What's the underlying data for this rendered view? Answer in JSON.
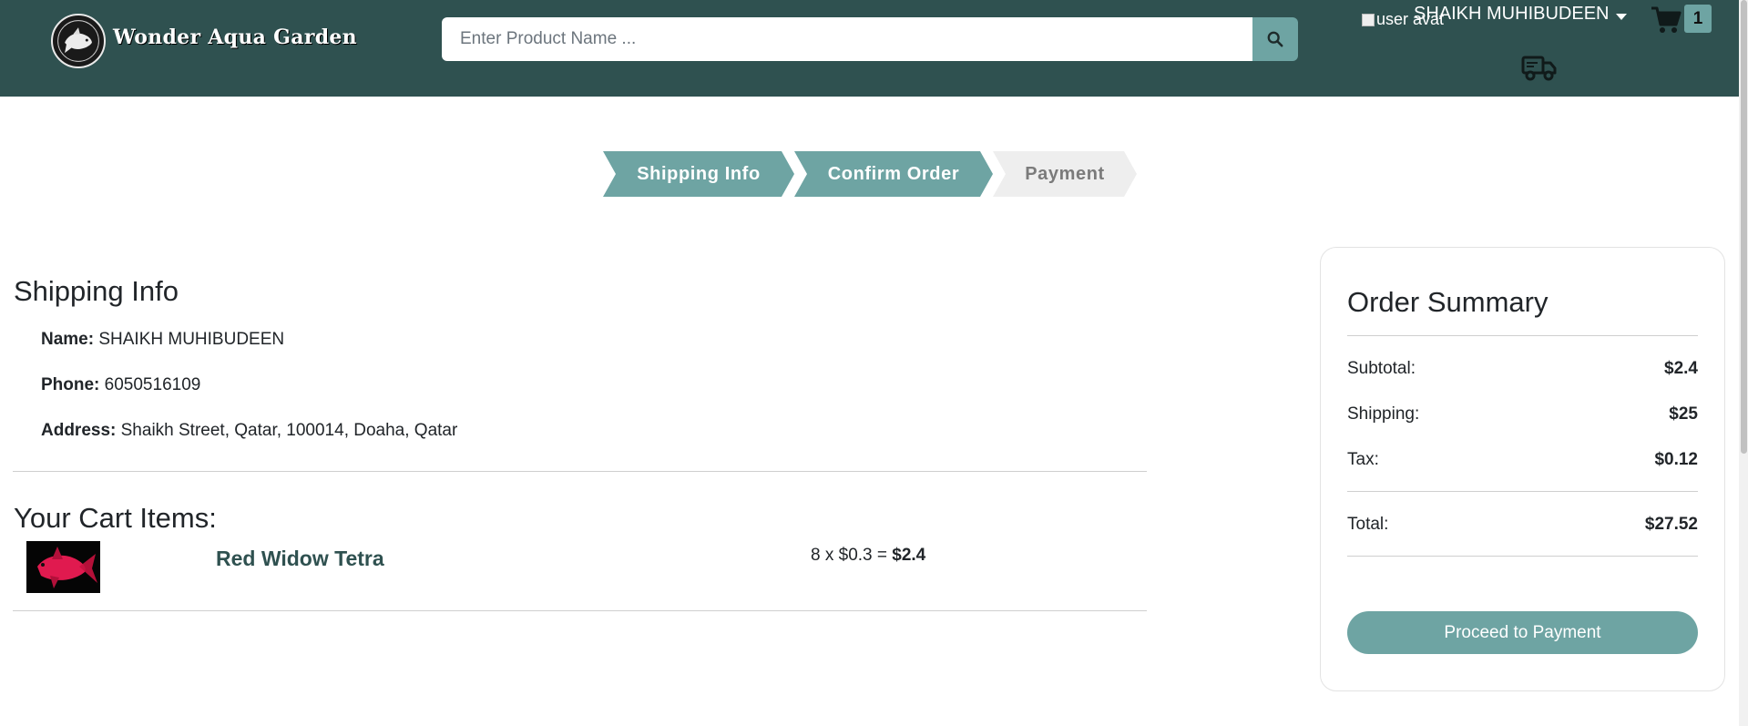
{
  "header": {
    "brand": "Wonder Aqua Garden",
    "logo_icon": "fish-logo-icon",
    "search": {
      "placeholder": "Enter Product Name ...",
      "button_icon": "search-icon"
    },
    "user": {
      "avatar_alt": "user avat",
      "name": "SHAIKH MUHIBUDEEN",
      "dropdown_icon": "caret-down-icon"
    },
    "cart": {
      "icon": "cart-icon",
      "count": "1"
    },
    "orders_icon": "truck-icon"
  },
  "steps": [
    {
      "label": "Shipping Info",
      "state": "active"
    },
    {
      "label": "Confirm Order",
      "state": "active"
    },
    {
      "label": "Payment",
      "state": "inactive"
    }
  ],
  "shipping": {
    "title": "Shipping Info",
    "name_label": "Name:",
    "name_value": " SHAIKH MUHIBUDEEN",
    "phone_label": "Phone:",
    "phone_value": " 6050516109",
    "address_label": "Address:",
    "address_value": " Shaikh Street, Qatar, 100014, Doaha, Qatar"
  },
  "cart_items": {
    "title": "Your Cart Items:",
    "items": [
      {
        "name": "Red Widow Tetra",
        "qty_price": "8 x $0.3 = ",
        "total": "$2.4"
      }
    ]
  },
  "summary": {
    "title": "Order Summary",
    "subtotal_label": "Subtotal:",
    "subtotal_value": "$2.4",
    "shipping_label": "Shipping:",
    "shipping_value": "$25",
    "tax_label": "Tax:",
    "tax_value": "$0.12",
    "total_label": "Total:",
    "total_value": "$27.52",
    "button": "Proceed to Payment"
  },
  "colors": {
    "header_bg": "#2f5150",
    "accent": "#6ea4a3",
    "step_inactive": "#eeeeee"
  }
}
